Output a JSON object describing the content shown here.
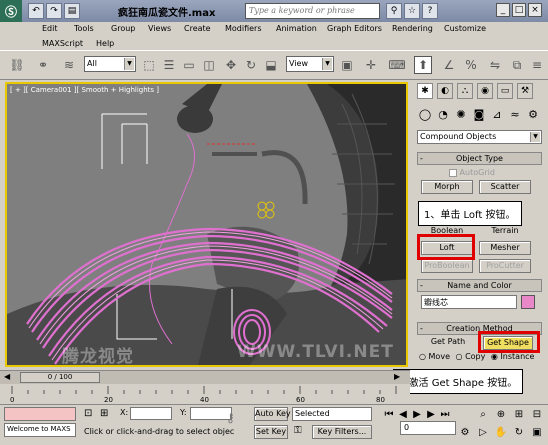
{
  "title": {
    "app_logo": "Ⓢ",
    "document": "疯狂南瓜瓷文件.max",
    "search_placeholder": "Type a keyword or phrase"
  },
  "menu": {
    "row1": [
      "Edit",
      "Tools",
      "Group",
      "Views",
      "Create",
      "Modifiers",
      "Animation",
      "Graph Editors",
      "Rendering",
      "Customize"
    ],
    "row2": [
      "MAXScript",
      "Help"
    ]
  },
  "toolbar": {
    "filter_value": "All",
    "coord_value": "View"
  },
  "viewport": {
    "label": "[ + ][ Camera001 ][ Smooth + Highlights ]",
    "watermark_left": "腾龙视觉",
    "watermark_right": "WWW.TLVI.NET"
  },
  "command_panel": {
    "dropdown_value": "Compound Objects",
    "object_type": {
      "header": "Object Type",
      "autogrid": "AutoGrid",
      "buttons": [
        "Morph",
        "Scatter",
        "Boolean",
        "Terrain",
        "Loft",
        "Mesher",
        "ProBoolean",
        "ProCutter"
      ]
    },
    "name_color": {
      "header": "Name and Color",
      "name_value": "瓣线芯"
    },
    "creation_method": {
      "header": "Creation Method",
      "get_path": "Get Path",
      "get_shape": "Get Shape",
      "move": "Move",
      "copy": "Copy",
      "instance": "Instance"
    }
  },
  "callouts": {
    "step1": "1、单击 Loft 按钮。",
    "step2": "2.激活 Get Shape 按钮。"
  },
  "timeline": {
    "slider": "0 / 100",
    "ticks": [
      "0",
      "20",
      "40",
      "60",
      "80",
      "100"
    ]
  },
  "status": {
    "welcome": "Welcome to MAXS",
    "prompt": "Click or click-and-drag to select objec",
    "x_label": "X:",
    "y_label": "Y:",
    "auto_key": "Auto Key",
    "set_key": "Set Key",
    "selected": "Selected",
    "key_filters": "Key Filters...",
    "frame": "0"
  },
  "colors": {
    "viewport_bg": "#7f7f7f",
    "viewport_border": "#e8c800",
    "loft_shape": "#e070d0",
    "callout_border": "#e00000",
    "get_shape_active": "#f0de60"
  }
}
